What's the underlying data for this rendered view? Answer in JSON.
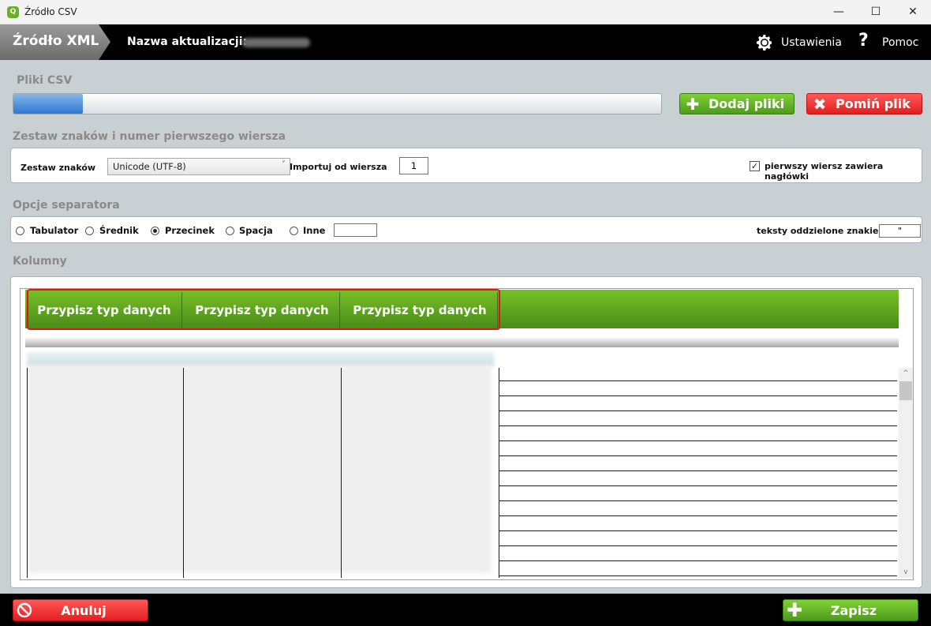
{
  "window": {
    "title": "Źródło CSV",
    "icon_letter": "Q",
    "minimize_glyph": "—",
    "maximize_glyph": "☐",
    "close_glyph": "✕"
  },
  "header": {
    "tab_label": "Źródło XML",
    "update_name_label": "Nazwa aktualizacji:",
    "settings_label": "Ustawienia",
    "help_glyph": "?",
    "help_label": "Pomoc"
  },
  "csv_files": {
    "section_title": "Pliki CSV",
    "progress_fraction": 0.107,
    "add_files_label": "Dodaj pliki",
    "skip_file_label": "Pomiń plik",
    "add_icon": "plus-icon",
    "skip_icon": "close-icon"
  },
  "charset": {
    "section_title": "Zestaw znaków i numer pierwszego wiersza",
    "charset_label": "Zestaw znaków",
    "charset_value": "Unicode (UTF-8)",
    "chevron": "˅",
    "import_from_label": "Importuj od wiersza",
    "import_from_value": "1",
    "header_checkbox_label": "pierwszy wiersz zawiera nagłówki",
    "header_checkbox_checked": true,
    "check_glyph": "✓"
  },
  "separator": {
    "section_title": "Opcje separatora",
    "options": [
      {
        "label": "Tabulator",
        "selected": false
      },
      {
        "label": "Średnik",
        "selected": false
      },
      {
        "label": "Przecinek",
        "selected": true
      },
      {
        "label": "Spacja",
        "selected": false
      },
      {
        "label": "Inne",
        "selected": false
      }
    ],
    "other_value": "",
    "text_qualifier_label": "teksty oddzielone znakiem",
    "text_qualifier_value": "\""
  },
  "columns": {
    "section_title": "Kolumny",
    "assign_buttons": [
      "Przypisz typ danych",
      "Przypisz typ danych",
      "Przypisz typ danych"
    ],
    "scroll_up": "^",
    "scroll_down": "v"
  },
  "footer": {
    "cancel_label": "Anuluj",
    "save_label": "Zapisz",
    "cancel_icon": "no-entry-icon",
    "save_icon": "plus-icon"
  },
  "colors": {
    "green": "#5aa820",
    "red": "#e82b2b",
    "header_bg": "#000000",
    "panel_bg": "#c8d0d3"
  }
}
